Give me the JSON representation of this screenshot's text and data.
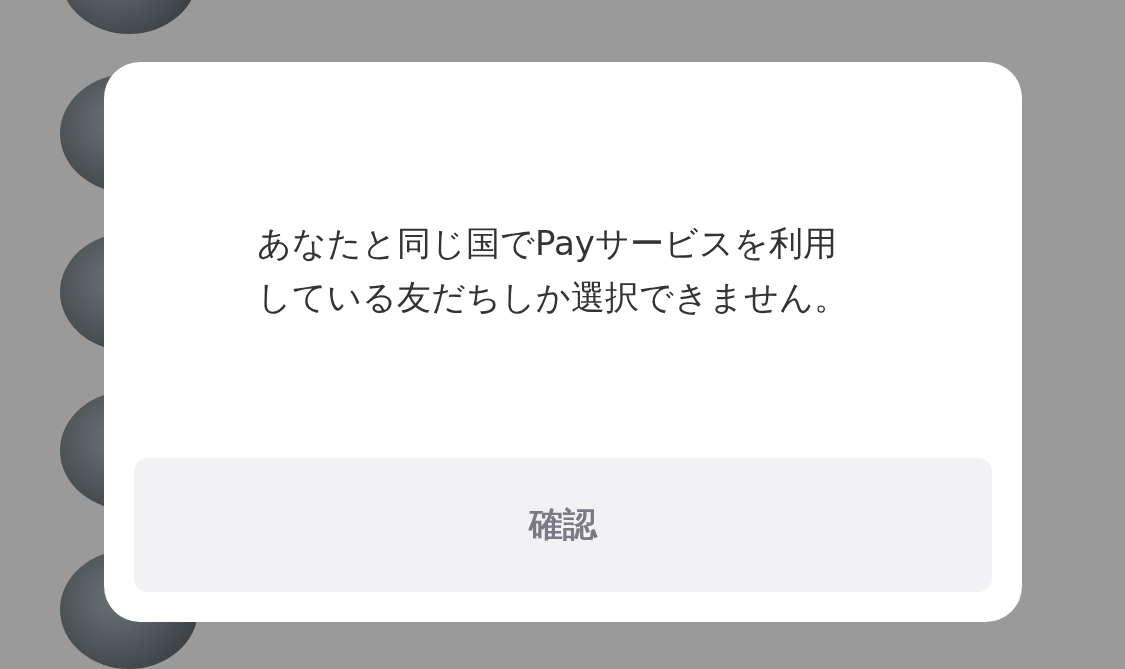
{
  "friends": [
    {
      "kind": "photo"
    },
    {
      "kind": "photo"
    },
    {
      "kind": "photo"
    },
    {
      "kind": "photo"
    },
    {
      "kind": "photo"
    }
  ],
  "dialog": {
    "message": "あなたと同じ国でPayサービスを利用している友だちしか選択できません。",
    "button": "確認"
  }
}
